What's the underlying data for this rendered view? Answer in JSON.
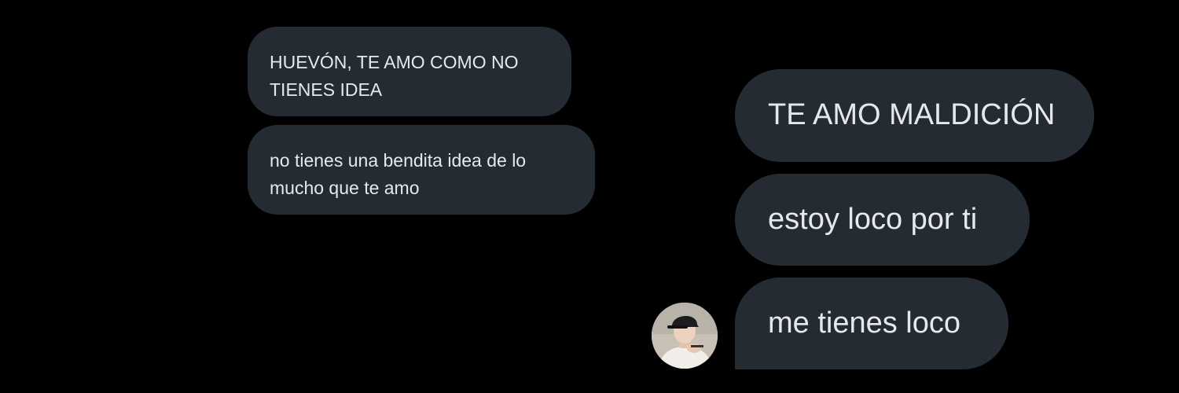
{
  "conversation": {
    "received": [
      {
        "text": "HUEVÓN, TE AMO COMO NO TIENES IDEA"
      },
      {
        "text": "no tienes una bendita idea de lo mucho que te amo"
      }
    ],
    "sent": [
      {
        "text": "TE AMO MALDICIÓN"
      },
      {
        "text": "estoy loco por ti"
      },
      {
        "text": "me tienes loco"
      }
    ]
  },
  "avatar": {
    "icon": "user-photo-avatar"
  },
  "colors": {
    "background": "#000000",
    "bubble": "#252b33",
    "text": "#e6e9ec"
  }
}
